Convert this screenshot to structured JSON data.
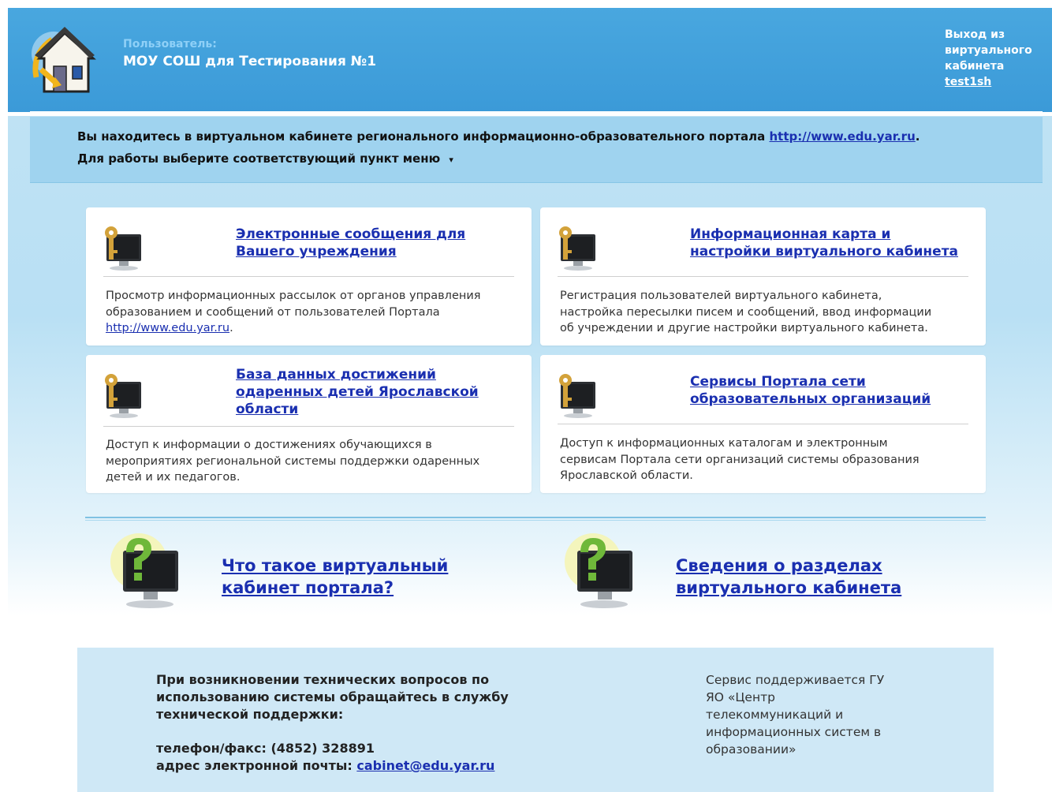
{
  "header": {
    "user_label": "Пользователь:",
    "user_name": "МОУ СОШ для Тестирования №1",
    "logout_label": "Выход из виртуального кабинета",
    "login": "test1sh",
    "colors": {
      "header_bg": "#3b9ad8",
      "accent_link": "#1a2fb0"
    }
  },
  "intro": {
    "text": "Вы находитесь в виртуальном кабинете регионального информационно-образовательного портала",
    "link": "http://www.edu.yar.ru",
    "after_link": ".",
    "menu_hint": "Для работы выберите соответствующий пункт меню",
    "menu_arrow": "▾"
  },
  "cards": [
    {
      "icon": "key-monitor-icon",
      "title_line1": "Электронные сообщения для",
      "title_line2": "Вашего учреждения",
      "desc_line1": "Просмотр информационных рассылок от органов управления",
      "desc_line2": "образованием и сообщений от пользователей Портала",
      "desc_link": "http://www.edu.yar.ru",
      "desc_after_link": "."
    },
    {
      "icon": "key-monitor-icon",
      "title_line1": "Информационная карта и",
      "title_line2": "настройки виртуального кабинета",
      "desc_line1": "Регистрация пользователей виртуального кабинета,",
      "desc_line2": "настройка пересылки писем и сообщений, ввод информации",
      "desc_line3": "об учреждении и другие настройки виртуального кабинета."
    },
    {
      "icon": "key-monitor-icon",
      "title_line1": "База данных достижений",
      "title_line2": "одаренных детей Ярославской",
      "title_line3": "области",
      "desc_line1": "Доступ к информации о достижениях обучающихся в",
      "desc_line2": "мероприятиях региональной системы поддержки одаренных",
      "desc_line3": "детей и их педагогов."
    },
    {
      "icon": "key-monitor-icon",
      "title_line1": "Сервисы Портала сети",
      "title_line2": "образовательных организаций",
      "desc_line1": "Доступ к информационных каталогам и электронным",
      "desc_line2": "сервисам Портала сети организаций системы образования",
      "desc_line3": "Ярославской области."
    }
  ],
  "help": [
    {
      "icon": "question-monitor-icon",
      "line1": "Что такое виртуальный",
      "line2": "кабинет портала?"
    },
    {
      "icon": "question-monitor-icon",
      "line1": "Сведения о разделах",
      "line2": "виртуального кабинета"
    }
  ],
  "footer": {
    "support_line1": "При возникновении технических вопросов по",
    "support_line2": "использованию системы обращайтесь в службу",
    "support_line3": "технической поддержки:",
    "phone": "телефон/факс: (4852) 328891",
    "email_label": "адрес электронной почты:",
    "email": "cabinet@edu.yar.ru",
    "service_line1": "Сервис поддерживается ГУ",
    "service_line2": "ЯО «Центр",
    "service_line3": "телекоммуникаций и",
    "service_line4": "информационных систем в",
    "service_line5": "образовании»"
  }
}
